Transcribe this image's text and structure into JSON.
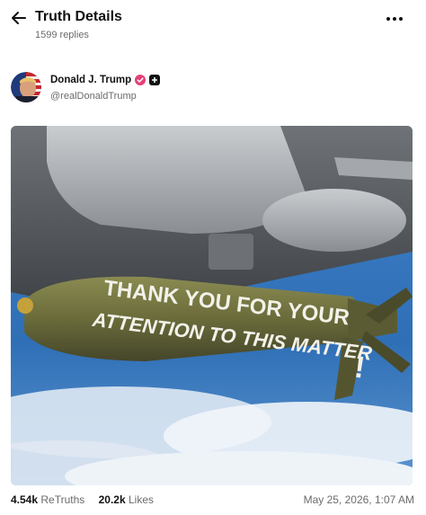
{
  "header": {
    "title": "Truth Details",
    "replies": "1599 replies"
  },
  "post": {
    "author_name": "Donald J. Trump",
    "handle": "@realDonaldTrump",
    "image_text_line1": "THANK YOU FOR YOUR",
    "image_text_line2": "ATTENTION TO THIS MATTER",
    "image_text_bang": "!",
    "retruths_count": "4.54k",
    "retruths_label": "ReTruths",
    "likes_count": "20.2k",
    "likes_label": "Likes",
    "timestamp": "May 25, 2026, 1:07 AM"
  },
  "colors": {
    "verified_badge": "#e4407a",
    "sky": "#2f6fb6",
    "bomb": "#6a6b3a"
  },
  "icons": {
    "back": "arrow-left-icon",
    "more": "more-horizontal-icon",
    "verified": "verified-check-icon",
    "badge": "plus-badge-icon"
  }
}
